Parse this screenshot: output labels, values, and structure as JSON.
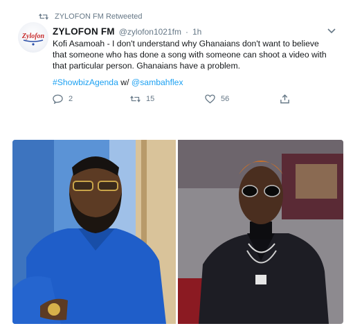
{
  "retweet": {
    "label": "ZYLOFON FM Retweeted"
  },
  "author": {
    "display_name": "ZYLOFON FM",
    "handle": "@zylofon1021fm",
    "separator": "·",
    "time": "1h",
    "avatar_text": "Zylofon"
  },
  "tweet": {
    "text": "Kofi Asamoah - I don't understand why Ghanaians don't want to believe that someone who has done a song with someone can shoot a video with that particular person. Ghanaians have a problem.",
    "hashtag": "#ShowbizAgenda",
    "with_text": "w/",
    "mention": "@sambahflex"
  },
  "actions": {
    "replies": "2",
    "retweets": "15",
    "likes": "56"
  },
  "colors": {
    "link": "#1da1f2",
    "muted": "#657786",
    "left_photo_bg": "#4f8bd0",
    "left_shirt": "#1f5ec9",
    "right_photo_bg": "#8a8388",
    "right_suit": "#1b1b22"
  },
  "icons": {
    "retweet_small": "retweet-icon",
    "reply": "reply-icon",
    "retweet": "retweet-icon",
    "like": "heart-icon",
    "share": "share-icon",
    "caret": "chevron-down-icon"
  }
}
